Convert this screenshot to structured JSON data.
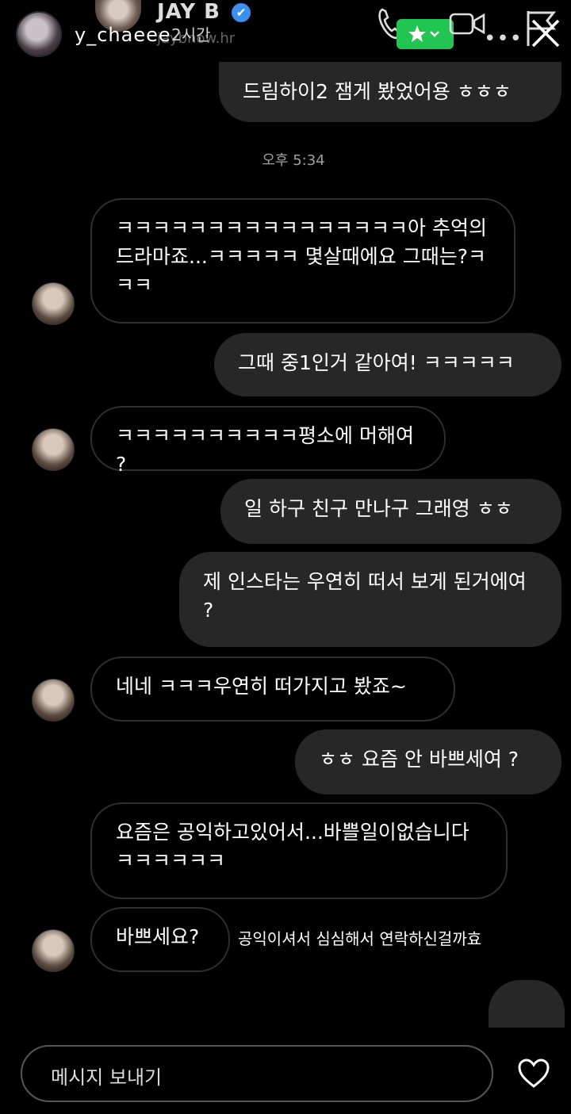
{
  "header": {
    "story_user": "y_chaeee",
    "story_time": "2시간",
    "chat_name": "JAY B",
    "chat_handle": "jaybnow.hr",
    "verified_mark": "✔",
    "more_label": "•••",
    "badge_color": "#23c552"
  },
  "messages": [
    {
      "dir": "out",
      "text": "드림하이2 잼게 봤었어용 ㅎㅎㅎ"
    },
    {
      "dir": "in",
      "text": "ㅋㅋㅋㅋㅋㅋㅋㅋㅋㅋㅋㅋㅋㅋㅋㅋ아 추억의 드라마죠...ㅋㅋㅋㅋㅋ 몇살때에요 그때는?ㅋㅋㅋ"
    },
    {
      "dir": "out",
      "text": "그때 중1인거 같아여! ㅋㅋㅋㅋㅋ"
    },
    {
      "dir": "in",
      "text": "ㅋㅋㅋㅋㅋㅋㅋㅋㅋㅋ평소에 머해여 ?"
    },
    {
      "dir": "out",
      "text": "일 하구 친구 만나구 그래영 ㅎㅎ"
    },
    {
      "dir": "out",
      "text": "제 인스타는 우연히 떠서 보게 된거에여 ?"
    },
    {
      "dir": "in",
      "text": "네네 ㅋㅋㅋ우연히 떠가지고 봤죠~"
    },
    {
      "dir": "out",
      "text": "ㅎㅎ 요즘 안 바쁘세여 ?"
    },
    {
      "dir": "in",
      "text": "요즘은 공익하고있어서...바쁠일이없습니다 ㅋㅋㅋㅋㅋㅋ"
    },
    {
      "dir": "in",
      "text": "바쁘세요?"
    }
  ],
  "timestamp": "오후 5:34",
  "story_caption": "공익이셔서 심심해서 연락하신걸까효",
  "composer": {
    "placeholder": "메시지 보내기"
  }
}
